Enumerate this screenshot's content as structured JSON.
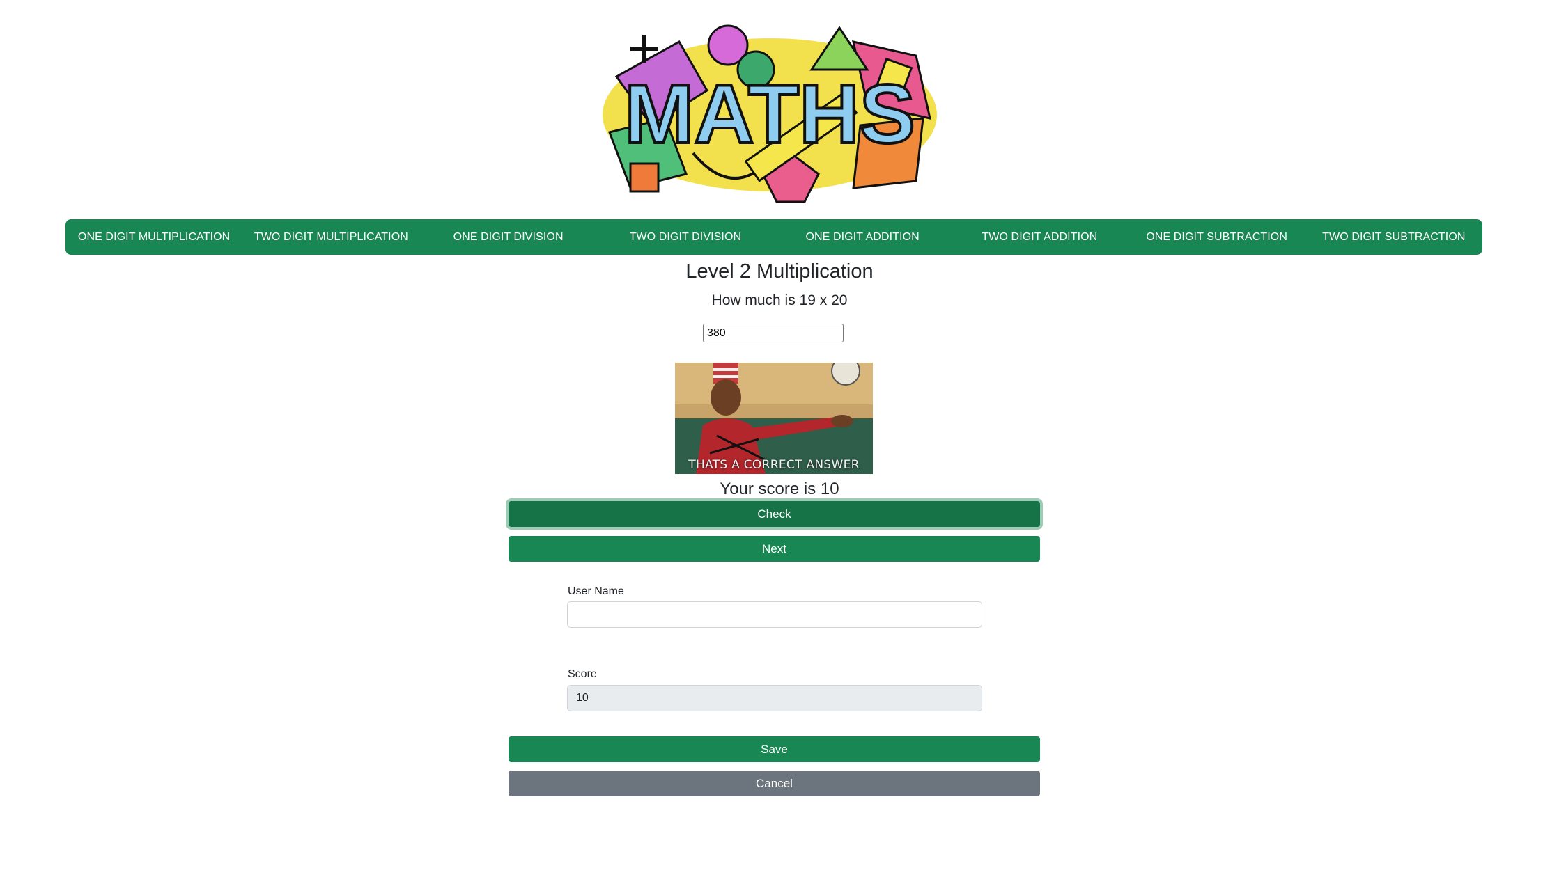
{
  "logo": {
    "text": "MATHS",
    "icon": "maths-doodle-logo"
  },
  "nav": {
    "items": [
      {
        "label": "ONE DIGIT MULTIPLICATION"
      },
      {
        "label": "TWO DIGIT MULTIPLICATION"
      },
      {
        "label": "ONE DIGIT DIVISION"
      },
      {
        "label": "TWO DIGIT DIVISION"
      },
      {
        "label": "ONE DIGIT ADDITION"
      },
      {
        "label": "TWO DIGIT ADDITION"
      },
      {
        "label": "ONE DIGIT SUBTRACTION"
      },
      {
        "label": "TWO DIGIT SUBTRACTION"
      }
    ]
  },
  "quiz": {
    "level_title": "Level 2 Multiplication",
    "question": "How much is 19 x 20",
    "answer_value": "380",
    "gif_caption": "THATS A CORRECT ANSWER",
    "score_text": "Your score is 10",
    "check_label": "Check",
    "next_label": "Next"
  },
  "form": {
    "user_label": "User Name",
    "user_value": "",
    "score_label": "Score",
    "score_value": "10",
    "save_label": "Save",
    "cancel_label": "Cancel"
  },
  "colors": {
    "primary_green": "#198754",
    "secondary_gray": "#6c757d",
    "disabled_bg": "#e9ecef"
  }
}
